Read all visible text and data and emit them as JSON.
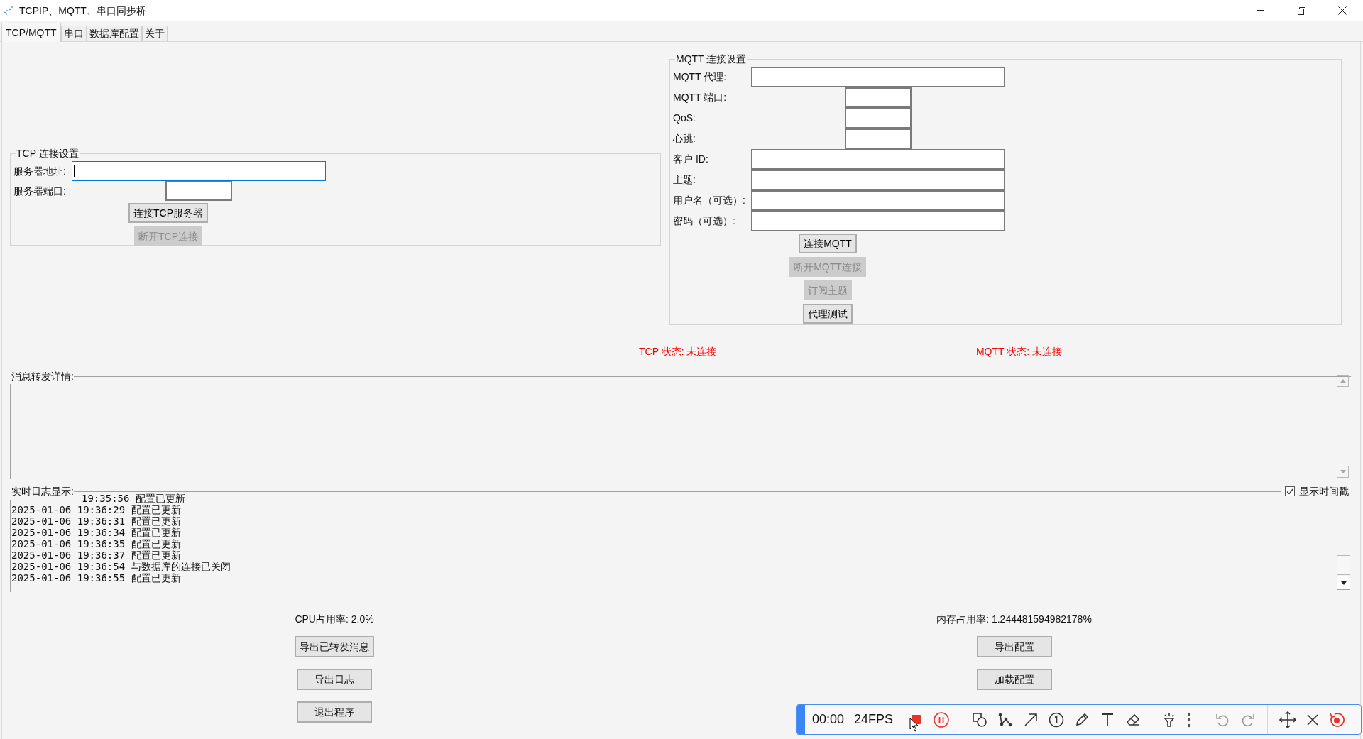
{
  "window": {
    "title": "TCPIP、MQTT、串口同步桥"
  },
  "tabs": [
    {
      "label": "TCP/MQTT",
      "selected": true
    },
    {
      "label": "串口",
      "selected": false
    },
    {
      "label": "数据库配置",
      "selected": false
    },
    {
      "label": "关于",
      "selected": false
    }
  ],
  "tcp_group": {
    "title": "TCP 连接设置",
    "fields": [
      {
        "label": "服务器地址:",
        "kind": "wide",
        "focused": true
      },
      {
        "label": "服务器端口:",
        "kind": "narrow",
        "focused": false
      }
    ],
    "buttons": [
      {
        "label": "连接TCP服务器",
        "disabled": false
      },
      {
        "label": "断开TCP连接",
        "disabled": true
      }
    ]
  },
  "mqtt_group": {
    "title": "MQTT 连接设置",
    "fields": [
      {
        "label": "MQTT 代理:",
        "kind": "wide",
        "focused": false
      },
      {
        "label": "MQTT 端口:",
        "kind": "narrow",
        "focused": false
      },
      {
        "label": "QoS:",
        "kind": "narrow",
        "focused": false
      },
      {
        "label": "心跳:",
        "kind": "narrow",
        "focused": false
      },
      {
        "label": "客户 ID:",
        "kind": "wide",
        "focused": false
      },
      {
        "label": "主题:",
        "kind": "wide",
        "focused": false
      },
      {
        "label": "用户名（可选）:",
        "kind": "wide",
        "focused": false
      },
      {
        "label": "密码（可选）:",
        "kind": "wide",
        "focused": false
      }
    ],
    "buttons": [
      {
        "label": "连接MQTT",
        "disabled": false
      },
      {
        "label": "断开MQTT连接",
        "disabled": true
      },
      {
        "label": "订阅主题",
        "disabled": true
      },
      {
        "label": "代理测试",
        "disabled": false
      }
    ]
  },
  "status": [
    {
      "text": "TCP 状态: 未连接"
    },
    {
      "text": "MQTT 状态: 未连接"
    }
  ],
  "message_details": {
    "label": "消息转发详情:"
  },
  "realtime_log": {
    "label": "实时日志显示:",
    "show_timestamp": {
      "label": "显示时间戳",
      "checked": true
    },
    "lines": [
      "19:35:56 配置已更新",
      "2025-01-06 19:36:29 配置已更新",
      "2025-01-06 19:36:31 配置已更新",
      "2025-01-06 19:36:34 配置已更新",
      "2025-01-06 19:36:35 配置已更新",
      "2025-01-06 19:36:37 配置已更新",
      "2025-01-06 19:36:54 与数据库的连接已关闭",
      "2025-01-06 19:36:55 配置已更新"
    ]
  },
  "cpu_usage": "CPU占用率: 2.0%",
  "memory_usage": "内存占用率: 1.244481594982178%",
  "left_buttons": [
    "导出已转发消息",
    "导出日志",
    "退出程序"
  ],
  "right_buttons": [
    "导出配置",
    "加载配置"
  ],
  "recorder_toolbar": {
    "time": "00:00",
    "fps": "24FPS"
  }
}
